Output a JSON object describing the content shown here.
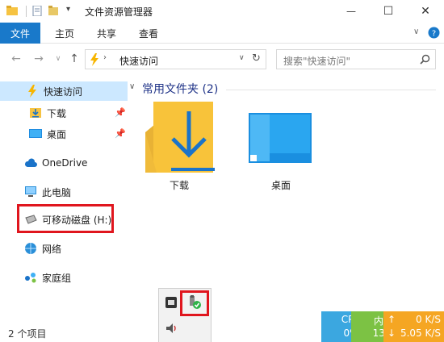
{
  "window": {
    "title": "文件资源管理器",
    "controls": {
      "minimize": "—",
      "maximize": "☐",
      "close": "✕"
    }
  },
  "ribbon": {
    "file_tab": "文件",
    "tabs": [
      "主页",
      "共享",
      "查看"
    ]
  },
  "address": {
    "path": "快速访问",
    "search_placeholder": "搜索\"快速访问\""
  },
  "sidebar": {
    "items": [
      {
        "label": "快速访问",
        "icon": "lightning-icon",
        "selected": true
      },
      {
        "label": "下载",
        "icon": "download-folder-icon",
        "pinned": true
      },
      {
        "label": "桌面",
        "icon": "desktop-icon",
        "pinned": true
      },
      {
        "label": "OneDrive",
        "icon": "cloud-icon"
      },
      {
        "label": "此电脑",
        "icon": "computer-icon"
      },
      {
        "label": "可移动磁盘 (H:)",
        "icon": "removable-drive-icon",
        "highlighted": true
      },
      {
        "label": "网络",
        "icon": "network-icon"
      },
      {
        "label": "家庭组",
        "icon": "homegroup-icon"
      }
    ]
  },
  "main": {
    "section_title": "常用文件夹 (2)",
    "folders": [
      {
        "label": "下载",
        "icon": "download-folder-icon"
      },
      {
        "label": "桌面",
        "icon": "desktop-folder-icon"
      }
    ]
  },
  "status": {
    "items_count": "2 个项目"
  },
  "tray": {
    "icons": [
      "bluetooth-icon",
      "safely-remove-hardware-icon",
      "speaker-icon"
    ],
    "highlighted": "safely-remove-hardware-icon"
  },
  "monitor": {
    "cpu_label": "CPU",
    "cpu_value": "0%",
    "mem_label": "内存",
    "mem_value": "13%",
    "upload": "0 K/S",
    "download": "5.05 K/S"
  },
  "colors": {
    "accent": "#1979ca",
    "selection": "#cce8ff",
    "highlight_border": "#e0161e",
    "cpu_bg": "#3ba7e0",
    "mem_bg": "#7cc244",
    "net_bg": "#f5a623"
  }
}
